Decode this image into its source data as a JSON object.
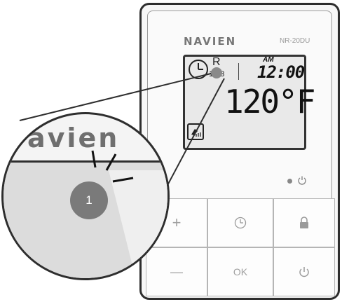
{
  "device": {
    "brand": "NAVIEN",
    "model": "NR-20DU"
  },
  "lcd": {
    "r_label": "R",
    "program_digits": "123",
    "ampm": "AM",
    "time": "12:00",
    "temperature": "120°F",
    "clock_icon": "clock-icon",
    "mode_icon": "shower-icon"
  },
  "indicators": {
    "status_icon": "power-icon"
  },
  "keypad": {
    "plus_label": "+",
    "clock_label": "clock-icon",
    "lock_label": "lock-icon",
    "minus_label": "—",
    "ok_label": "OK",
    "power_label": "power-icon"
  },
  "magnifier": {
    "brand": "avien",
    "badge_number": "1"
  }
}
